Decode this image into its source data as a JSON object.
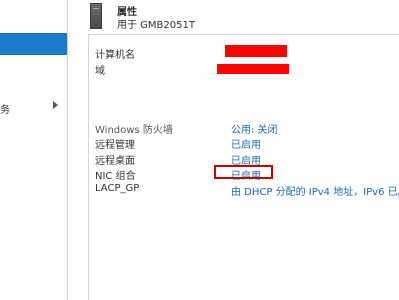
{
  "nav": {
    "partial_item_label": "务"
  },
  "header": {
    "title": "属性",
    "subtitle": "用于 GMB2051T"
  },
  "properties": [
    {
      "label": "计算机名",
      "value": ""
    },
    {
      "label": "域",
      "value": ""
    },
    {
      "label": "Windows 防火墙",
      "value": "公用: 关闭"
    },
    {
      "label": "远程管理",
      "value": "已启用"
    },
    {
      "label": "远程桌面",
      "value": "已启用"
    },
    {
      "label": "NIC 组合",
      "value": "已启用"
    },
    {
      "label": "LACP_GP",
      "value": "由 DHCP 分配的 IPv4 地址，IPv6 已启"
    }
  ],
  "colors": {
    "nav_selected": "#1979ca",
    "link": "#1a6bb3",
    "redaction": "#ff0000",
    "highlight_box": "#c00000"
  }
}
